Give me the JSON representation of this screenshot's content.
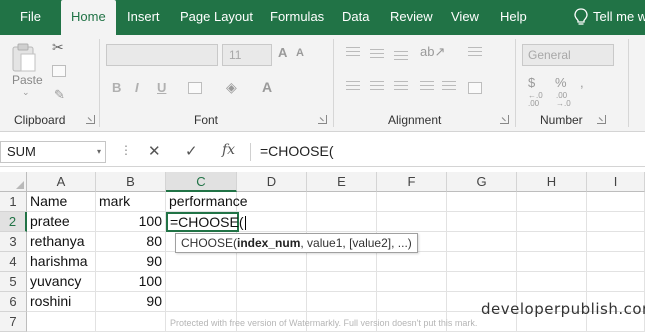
{
  "ribbon_tabs": [
    {
      "label": "File"
    },
    {
      "label": "Home"
    },
    {
      "label": "Insert"
    },
    {
      "label": "Page Layout"
    },
    {
      "label": "Formulas"
    },
    {
      "label": "Data"
    },
    {
      "label": "Review"
    },
    {
      "label": "View"
    },
    {
      "label": "Help"
    },
    {
      "label": "Tell me wha"
    }
  ],
  "ribbon": {
    "paste_label": "Paste",
    "font_size": "11",
    "bold": "B",
    "italic": "I",
    "underline": "U",
    "number_format": "General",
    "currency_symbol": "$",
    "percent_symbol": "%",
    "groups": {
      "clipboard": "Clipboard",
      "font": "Font",
      "alignment": "Alignment",
      "number": "Number"
    }
  },
  "formula_bar": {
    "name_box": "SUM",
    "cancel_symbol": "✕",
    "enter_symbol": "✓",
    "fx_symbol": "fx",
    "content": "=CHOOSE("
  },
  "columns": [
    "A",
    "B",
    "C",
    "D",
    "E",
    "F",
    "G",
    "H",
    "I"
  ],
  "rows": [
    "1",
    "2",
    "3",
    "4",
    "5",
    "6",
    "7"
  ],
  "cells": {
    "A1": "Name",
    "B1": "mark",
    "C1": "performance",
    "A2": "pratee",
    "B2": "100",
    "C2": "=CHOOSE(",
    "A3": "rethanya",
    "B3": "80",
    "A4": "harishma",
    "B4": "90",
    "A5": "yuvancy",
    "B5": "100",
    "A6": "roshini",
    "B6": "90"
  },
  "tooltip": {
    "func": "CHOOSE(",
    "arg_bold": "index_num",
    "rest": ", value1, [value2], ...)"
  },
  "watermark": {
    "logo": "developerpublish.com",
    "trial": "Protected with free version of Watermarkly. Full version doesn't put this mark."
  },
  "colors": {
    "brand_green": "#217346",
    "ribbon_bg": "#f3f3f3"
  }
}
